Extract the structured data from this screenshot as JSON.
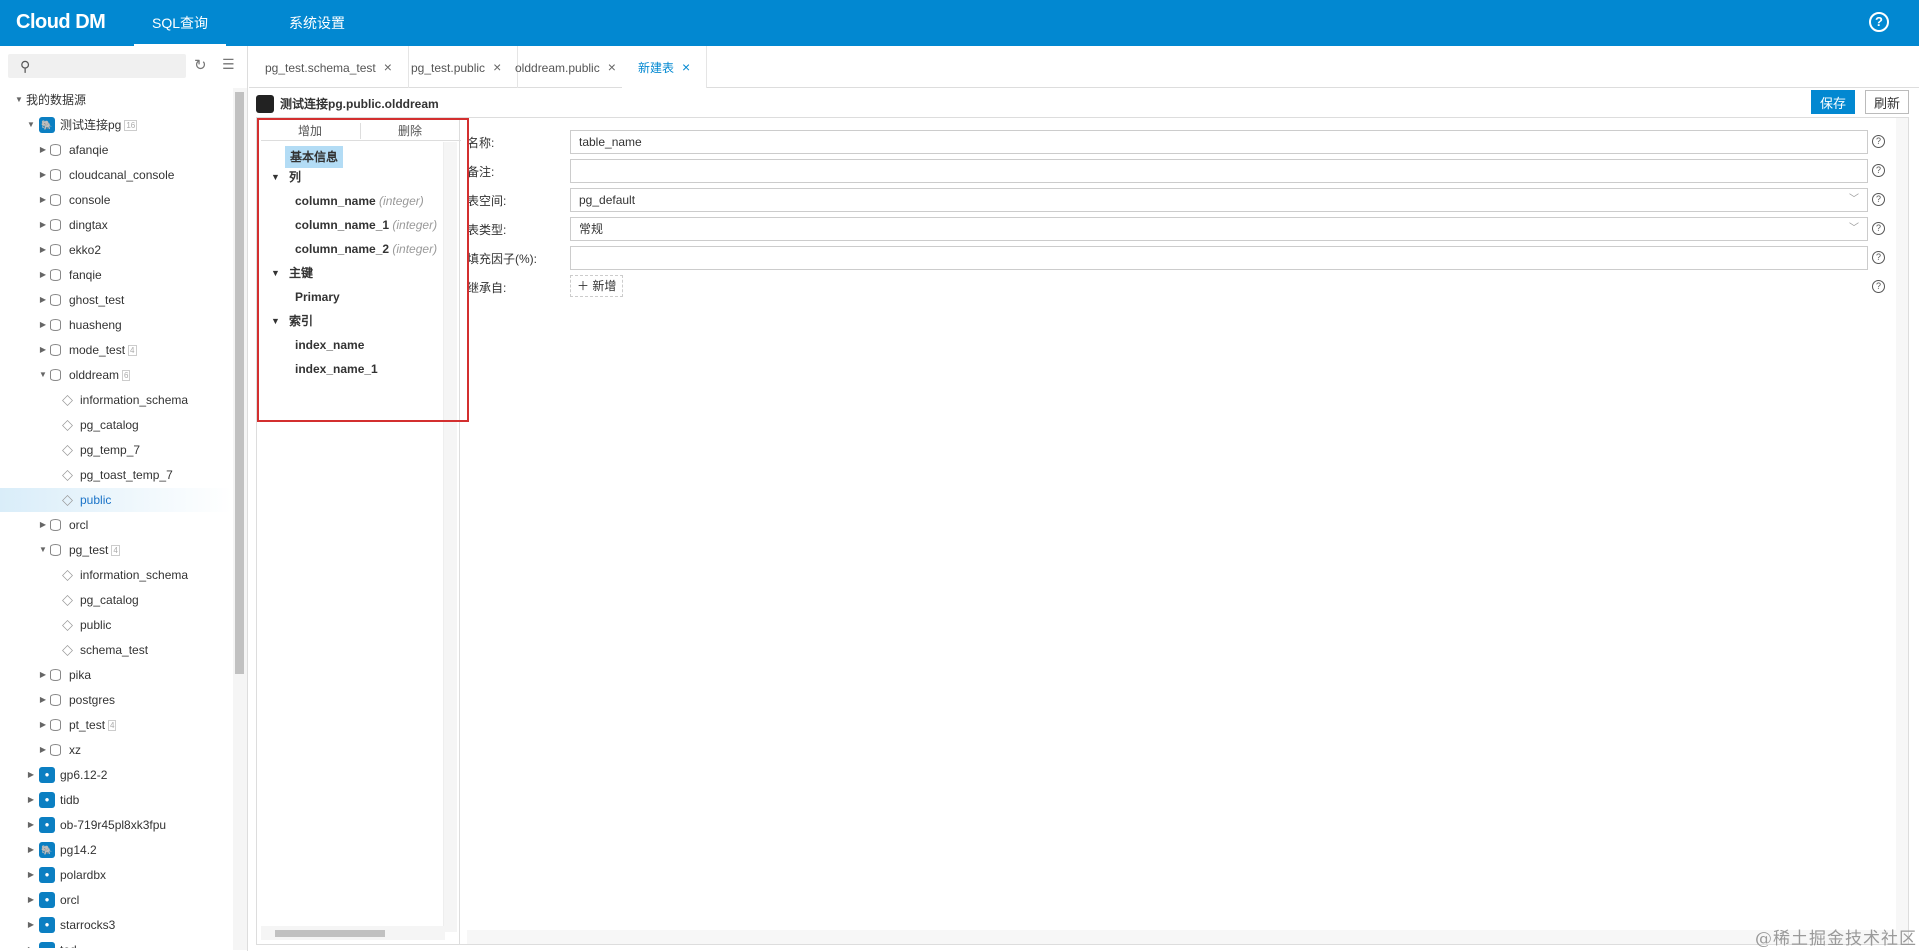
{
  "app": {
    "logo_cloud": "Cloud",
    "logo_dm": "DM"
  },
  "nav": {
    "sql": "SQL查询",
    "settings": "系统设置"
  },
  "sidebar": {
    "search_placeholder": "",
    "items": [
      {
        "label": "我的数据源",
        "level": 0,
        "arrow": "▼",
        "icon": "none"
      },
      {
        "label": "测试连接pg",
        "level": 1,
        "arrow": "▼",
        "icon": "pg",
        "count": "16"
      },
      {
        "label": "afanqie",
        "level": 2,
        "arrow": "▶",
        "icon": "db"
      },
      {
        "label": "cloudcanal_console",
        "level": 2,
        "arrow": "▶",
        "icon": "db"
      },
      {
        "label": "console",
        "level": 2,
        "arrow": "▶",
        "icon": "db"
      },
      {
        "label": "dingtax",
        "level": 2,
        "arrow": "▶",
        "icon": "db"
      },
      {
        "label": "ekko2",
        "level": 2,
        "arrow": "▶",
        "icon": "db"
      },
      {
        "label": "fanqie",
        "level": 2,
        "arrow": "▶",
        "icon": "db"
      },
      {
        "label": "ghost_test",
        "level": 2,
        "arrow": "▶",
        "icon": "db"
      },
      {
        "label": "huasheng",
        "level": 2,
        "arrow": "▶",
        "icon": "db"
      },
      {
        "label": "mode_test",
        "level": 2,
        "arrow": "▶",
        "icon": "db",
        "count": "4"
      },
      {
        "label": "olddream",
        "level": 2,
        "arrow": "▼",
        "icon": "db",
        "count": "6"
      },
      {
        "label": "information_schema",
        "level": 3,
        "arrow": "",
        "icon": "schema"
      },
      {
        "label": "pg_catalog",
        "level": 3,
        "arrow": "",
        "icon": "schema"
      },
      {
        "label": "pg_temp_7",
        "level": 3,
        "arrow": "",
        "icon": "schema"
      },
      {
        "label": "pg_toast_temp_7",
        "level": 3,
        "arrow": "",
        "icon": "schema"
      },
      {
        "label": "public",
        "level": 3,
        "arrow": "",
        "icon": "schema",
        "selected": true
      },
      {
        "label": "orcl",
        "level": 2,
        "arrow": "▶",
        "icon": "db"
      },
      {
        "label": "pg_test",
        "level": 2,
        "arrow": "▼",
        "icon": "db",
        "count": "4"
      },
      {
        "label": "information_schema",
        "level": 3,
        "arrow": "",
        "icon": "schema"
      },
      {
        "label": "pg_catalog",
        "level": 3,
        "arrow": "",
        "icon": "schema"
      },
      {
        "label": "public",
        "level": 3,
        "arrow": "",
        "icon": "schema"
      },
      {
        "label": "schema_test",
        "level": 3,
        "arrow": "",
        "icon": "schema"
      },
      {
        "label": "pika",
        "level": 2,
        "arrow": "▶",
        "icon": "db"
      },
      {
        "label": "postgres",
        "level": 2,
        "arrow": "▶",
        "icon": "db"
      },
      {
        "label": "pt_test",
        "level": 2,
        "arrow": "▶",
        "icon": "db",
        "count": "4"
      },
      {
        "label": "xz",
        "level": 2,
        "arrow": "▶",
        "icon": "db"
      },
      {
        "label": "gp6.12-2",
        "level": 1,
        "arrow": "▶",
        "icon": "conn"
      },
      {
        "label": "tidb",
        "level": 1,
        "arrow": "▶",
        "icon": "conn"
      },
      {
        "label": "ob-719r45pl8xk3fpu",
        "level": 1,
        "arrow": "▶",
        "icon": "conn"
      },
      {
        "label": "pg14.2",
        "level": 1,
        "arrow": "▶",
        "icon": "pg"
      },
      {
        "label": "polardbx",
        "level": 1,
        "arrow": "▶",
        "icon": "conn"
      },
      {
        "label": "orcl",
        "level": 1,
        "arrow": "▶",
        "icon": "conn"
      },
      {
        "label": "starrocks3",
        "level": 1,
        "arrow": "▶",
        "icon": "conn"
      },
      {
        "label": "tod",
        "level": 1,
        "arrow": "▶",
        "icon": "conn"
      }
    ]
  },
  "tabs": [
    {
      "label": "pg_test.schema_test",
      "close": "×"
    },
    {
      "label": "pg_test.public",
      "close": "×"
    },
    {
      "label": "olddream.public",
      "close": "×"
    },
    {
      "label": "新建表",
      "close": "×",
      "active": true
    }
  ],
  "header": {
    "path": "测试连接pg.public.olddream",
    "save": "保存",
    "refresh": "刷新"
  },
  "structure": {
    "add": "增加",
    "delete": "删除",
    "basic_info": "基本信息",
    "columns_title": "列",
    "columns": [
      {
        "name": "column_name",
        "type": "(integer)"
      },
      {
        "name": "column_name_1",
        "type": "(integer)"
      },
      {
        "name": "column_name_2",
        "type": "(integer)"
      }
    ],
    "pk_title": "主键",
    "pk_items": [
      "Primary"
    ],
    "index_title": "索引",
    "index_items": [
      "index_name",
      "index_name_1"
    ]
  },
  "form": {
    "name_label": "名称:",
    "name_value": "table_name",
    "comment_label": "备注:",
    "comment_value": "",
    "tablespace_label": "表空间:",
    "tablespace_value": "pg_default",
    "tabletype_label": "表类型:",
    "tabletype_value": "常规",
    "fillfactor_label": "填充因子(%):",
    "fillfactor_value": "",
    "inherit_label": "继承自:",
    "inherit_add": "＋ 新增"
  },
  "watermark": "@稀土掘金技术社区"
}
